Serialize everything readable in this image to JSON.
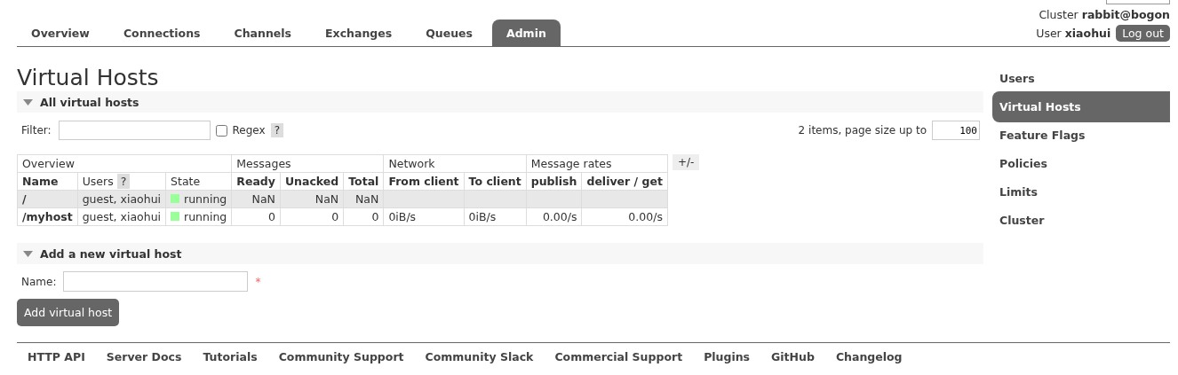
{
  "header": {
    "cluster_label": "Cluster",
    "cluster": "rabbit@bogon",
    "user_label": "User",
    "user": "xiaohui",
    "logout": "Log out"
  },
  "tabs": [
    {
      "label": "Overview",
      "selected": false
    },
    {
      "label": "Connections",
      "selected": false
    },
    {
      "label": "Channels",
      "selected": false
    },
    {
      "label": "Exchanges",
      "selected": false
    },
    {
      "label": "Queues",
      "selected": false
    },
    {
      "label": "Admin",
      "selected": true
    }
  ],
  "title": "Virtual Hosts",
  "all_section": {
    "title": "All virtual hosts",
    "filter_label": "Filter:",
    "regex": {
      "label": "Regex",
      "checked": false
    },
    "help": "?",
    "paging": "2 items, page size up to",
    "page_size": "100"
  },
  "table": {
    "toggle": "+/-",
    "groups": [
      {
        "label": "Overview",
        "columns": [
          {
            "label": "Name",
            "kind": "name"
          },
          {
            "label": "Users",
            "kind": "text",
            "help": "?"
          },
          {
            "label": "State",
            "kind": "state"
          }
        ]
      },
      {
        "label": "Messages",
        "columns": [
          {
            "label": "Ready",
            "kind": "num"
          },
          {
            "label": "Unacked",
            "kind": "num"
          },
          {
            "label": "Total",
            "kind": "num"
          }
        ]
      },
      {
        "label": "Network",
        "columns": [
          {
            "label": "From client",
            "kind": "text"
          },
          {
            "label": "To client",
            "kind": "text"
          }
        ]
      },
      {
        "label": "Message rates",
        "columns": [
          {
            "label": "publish",
            "kind": "num"
          },
          {
            "label": "deliver / get",
            "kind": "num"
          }
        ]
      }
    ],
    "rows": [
      {
        "cells": [
          "/",
          "guest, xiaohui",
          "running",
          "NaN",
          "NaN",
          "NaN",
          "",
          "",
          "",
          ""
        ]
      },
      {
        "cells": [
          "/myhost",
          "guest, xiaohui",
          "running",
          "0",
          "0",
          "0",
          "0iB/s",
          "0iB/s",
          "0.00/s",
          "0.00/s"
        ]
      }
    ]
  },
  "add_section": {
    "title": "Add a new virtual host",
    "name_label": "Name:",
    "required": "*",
    "button": "Add virtual host"
  },
  "sidebar": [
    {
      "label": "Users",
      "selected": false
    },
    {
      "label": "Virtual Hosts",
      "selected": true
    },
    {
      "label": "Feature Flags",
      "selected": false
    },
    {
      "label": "Policies",
      "selected": false
    },
    {
      "label": "Limits",
      "selected": false
    },
    {
      "label": "Cluster",
      "selected": false
    }
  ],
  "footer": [
    "HTTP API",
    "Server Docs",
    "Tutorials",
    "Community Support",
    "Community Slack",
    "Commercial Support",
    "Plugins",
    "GitHub",
    "Changelog"
  ]
}
